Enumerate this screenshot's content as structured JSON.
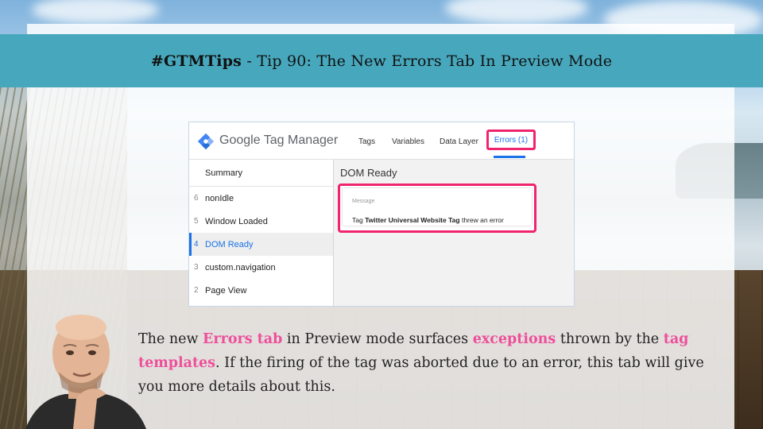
{
  "slide": {
    "title_bold": "#GTMTips",
    "title_rest": " - Tip 90: The New Errors Tab In Preview Mode"
  },
  "gtm": {
    "brand": "Google Tag Manager",
    "tabs": [
      "Tags",
      "Variables",
      "Data Layer"
    ],
    "errors_tab": "Errors (1)",
    "sidebar": {
      "summary": "Summary",
      "items": [
        {
          "num": "6",
          "label": "nonIdle"
        },
        {
          "num": "5",
          "label": "Window Loaded"
        },
        {
          "num": "4",
          "label": "DOM Ready"
        },
        {
          "num": "3",
          "label": "custom.navigation"
        },
        {
          "num": "2",
          "label": "Page View"
        }
      ],
      "active_index": 2
    },
    "main": {
      "title": "DOM Ready",
      "message_label": "Message",
      "message_prefix": "Tag ",
      "message_tag": "Twitter Universal Website Tag",
      "message_suffix": " threw an error"
    }
  },
  "caption": {
    "p1": "The new ",
    "h1": "Errors tab",
    "p2": " in Preview mode surfaces ",
    "h2": "exceptions",
    "p3": " thrown by the ",
    "h3": "tag templates",
    "p4": ". If the firing of the tag was aborted due to an error, this tab will give you more details about this."
  },
  "colors": {
    "banner": "#47a8bd",
    "highlight": "#ee4f9b",
    "error_outline": "#f0236e",
    "gtm_blue": "#1a73e8"
  }
}
